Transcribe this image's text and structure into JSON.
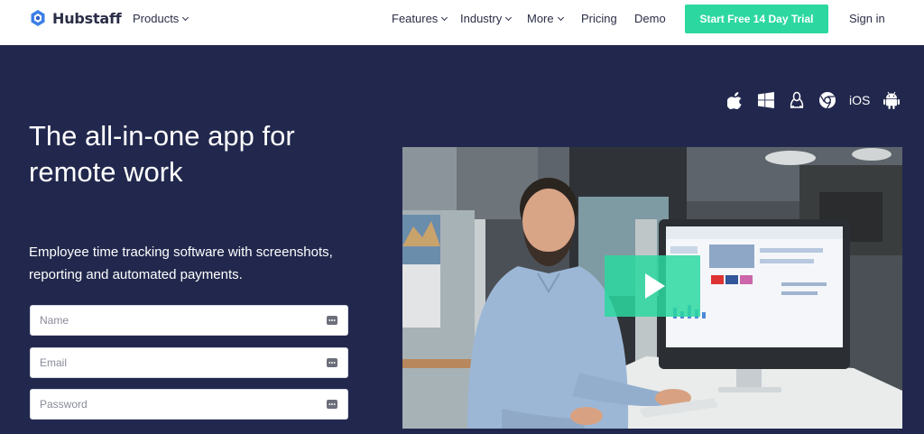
{
  "brand": {
    "name": "Hubstaff",
    "accent": "#2cd8a0",
    "hero_bg": "#22284d"
  },
  "nav": {
    "products": "Products",
    "features": "Features",
    "industry": "Industry",
    "more": "More",
    "pricing": "Pricing",
    "demo": "Demo",
    "cta": "Start Free 14 Day Trial",
    "sign_in": "Sign in"
  },
  "platforms": {
    "icons": [
      "apple-icon",
      "windows-icon",
      "linux-icon",
      "chrome-icon",
      "ios-label",
      "android-icon"
    ],
    "ios": "iOS"
  },
  "hero": {
    "title": "The all-in-one app for remote work",
    "subtitle": "Employee time tracking software with screenshots, reporting and automated payments."
  },
  "form": {
    "name_placeholder": "Name",
    "email_placeholder": "Email",
    "password_placeholder": "Password"
  }
}
